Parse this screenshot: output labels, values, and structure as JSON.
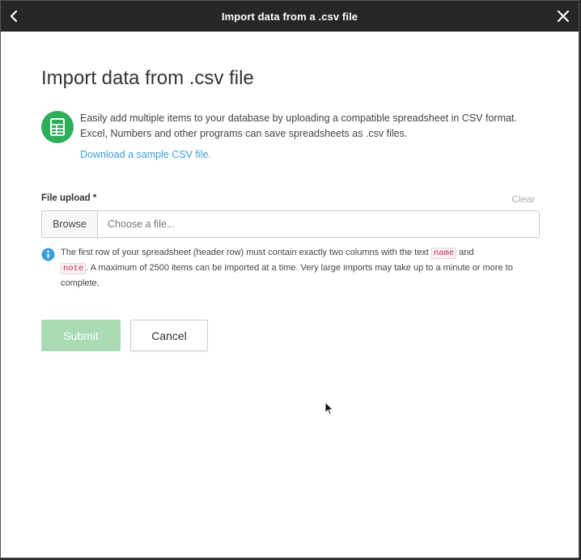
{
  "titlebar": {
    "title": "Import data from a .csv file",
    "back_icon": "chevron-left-icon",
    "close_icon": "close-icon",
    "background": "#262626"
  },
  "main": {
    "heading": "Import data from .csv file",
    "intro": {
      "icon": "spreadsheet-icon",
      "icon_color": "#2fae5a",
      "line1": "Easily add multiple items to your database by uploading a compatible spreadsheet in CSV format.",
      "line2": "Excel, Numbers and other programs can save spreadsheets as .csv files.",
      "sample_link": "Download a sample CSV file."
    },
    "upload": {
      "label": "File upload *",
      "clear_label": "Clear",
      "browse_label": "Browse",
      "placeholder": "Choose a file..."
    },
    "info": {
      "icon": "info-icon",
      "text_before": "The first row of your spreadsheet (header row) must contain exactly two columns with the text",
      "code1": "name",
      "text_mid": "and",
      "code2": "note",
      "text_after": ". A maximum of 2500 items can be imported at a time. Very large imports may take up to a minute or more to complete."
    },
    "actions": {
      "submit_label": "Submit",
      "cancel_label": "Cancel",
      "submit_color": "#a9dcb5"
    }
  },
  "accent_link_color": "#3d9ed8"
}
